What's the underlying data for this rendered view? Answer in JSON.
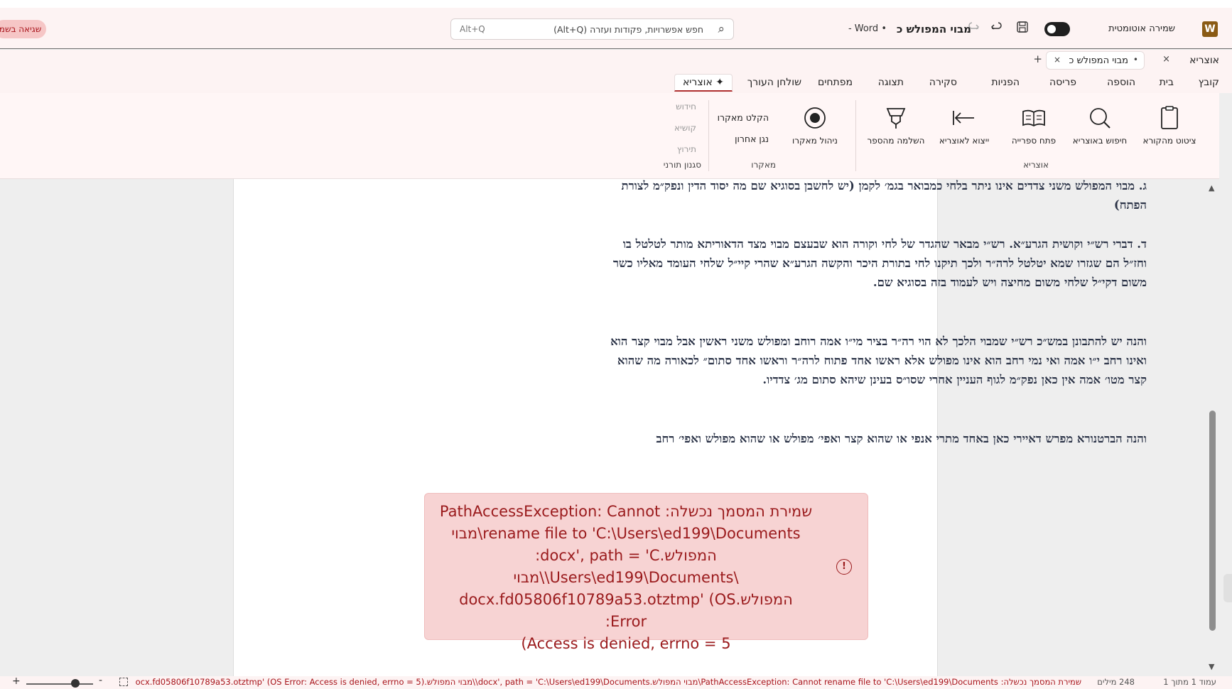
{
  "app": {
    "logo_letter": "W",
    "autosave_label": "שמירה אוטומטית",
    "document_title": "מבוי המפולש כ",
    "app_suffix": "• Word -",
    "error_pill": "שגיאה בשמ"
  },
  "search": {
    "placeholder": "חפש אפשרויות, פקודות ועזרה (Alt+Q)",
    "shortcut": "Alt+Q"
  },
  "tabs": {
    "side_label": "אוצריא",
    "document_tab": "מבוי המפולש כ",
    "document_tab_dot": "•",
    "close_glyph": "×",
    "add_glyph": "+"
  },
  "menu": [
    "קובץ",
    "בית",
    "הוספה",
    "פריסה",
    "הפניות",
    "סקירה",
    "תצוגה",
    "מפתחים",
    "שולחן העורך",
    "✦ אוצריא"
  ],
  "ribbon": {
    "otzaria_group": {
      "label": "אוצריא",
      "buttons": [
        "ציטוט מהקורא",
        "חיפוש באוצריא",
        "פתח ספרייה",
        "ייצוא לאוצריא",
        "השלמה מהספר"
      ]
    },
    "macro_group": {
      "label": "מאקרו",
      "manage": "ניהול מאקרו",
      "record": "הקלט מאקרו",
      "play_last": "נגן אחרון"
    },
    "torah_style": {
      "label": "סגנון תורני",
      "items": [
        "חידוש",
        "קושיא",
        "תירוץ"
      ]
    }
  },
  "document": {
    "paragraphs": [
      "ג. מבוי המפולש משני צדדים אינו ניתר בלחי כמבואר בגמ׳ לקמן (יש לחשבן בסוגיא שם מה יסוד הדין ונפק״מ לצורת הפתח)",
      "ד. דברי רש״י וקושית הגרע״א. רש״י מבאר שהגדר של לחי וקורה הוא שבעצם מבוי מצד הדאוריתא מותר לטלטל בו וחז״ל הם שגזרו שמא יטלטל לרה״ר ולכך תיקנו לחי בתורת היכר והקשה הגרע״א שהרי קיי״ל שלחי העומד מאליו כשר משום דקי״ל שלחי משום מחיצה ויש לעמוד בזה בסוגיא שם.",
      "והנה יש להתבונן במש״כ רש״י שמבוי הלכך לא הוי רה״ר בציר מי״ו אמה רוחב ומפולש משני ראשין אבל מבוי קצר הוא ואינו רחב י״ו אמה ואי נמי רחב הוא אינו מפולש אלא ראשו אחד פתוח לרה״ר וראשו אחד סתום״ לכאורה מה שהוא קצר מטו׳ אמה אין כאן נפק״מ לגוף העניין אחרי שסו״ס בעינן שיהא סתום מג׳ צדדיו.",
      "והנה הברטנורא מפרש דאיירי כאן באחד מתרי אנפי או שהוא קצר ואפי׳ מפולש או שהוא מפולש ואפי׳ רחב"
    ]
  },
  "error_box": {
    "lines": [
      "שמירת המסמך נכשלה: PathAccessException: Cannot",
      "rename file to 'C:\\Users\\ed199\\Documents\\מבוי",
      "המפולש.docx', path = 'C:",
      "\\Users\\ed199\\Documents\\\\מבוי",
      "המפולש.docx.fd05806f10789a53.otztmp' (OS Error:",
      "Access is denied, errno = 5)"
    ],
    "icon": "!"
  },
  "status": {
    "page": "עמוד 1 מתוך 1",
    "words": "248 מילים",
    "error": "שמירת המסמך נכשלה: PathAccessException: Cannot rename file to 'C:\\Users\\ed199\\Documents\\מבוי המפולש.docx', path = 'C:\\Users\\ed199\\Documents\\\\מבוי המפולש.docx.fd05806f10789a53.otztmp' (OS Error: Access is denied, errno = 5)",
    "zoom_plus": "+",
    "zoom_minus": "-",
    "zoom_level_fraction": 0.67
  },
  "colors": {
    "accent": "#b03030",
    "error_text": "#9a1a1c",
    "error_bg": "#f7d3d3",
    "chrome_bg": "#fdf3f3",
    "doc_text": "#2b3347"
  }
}
